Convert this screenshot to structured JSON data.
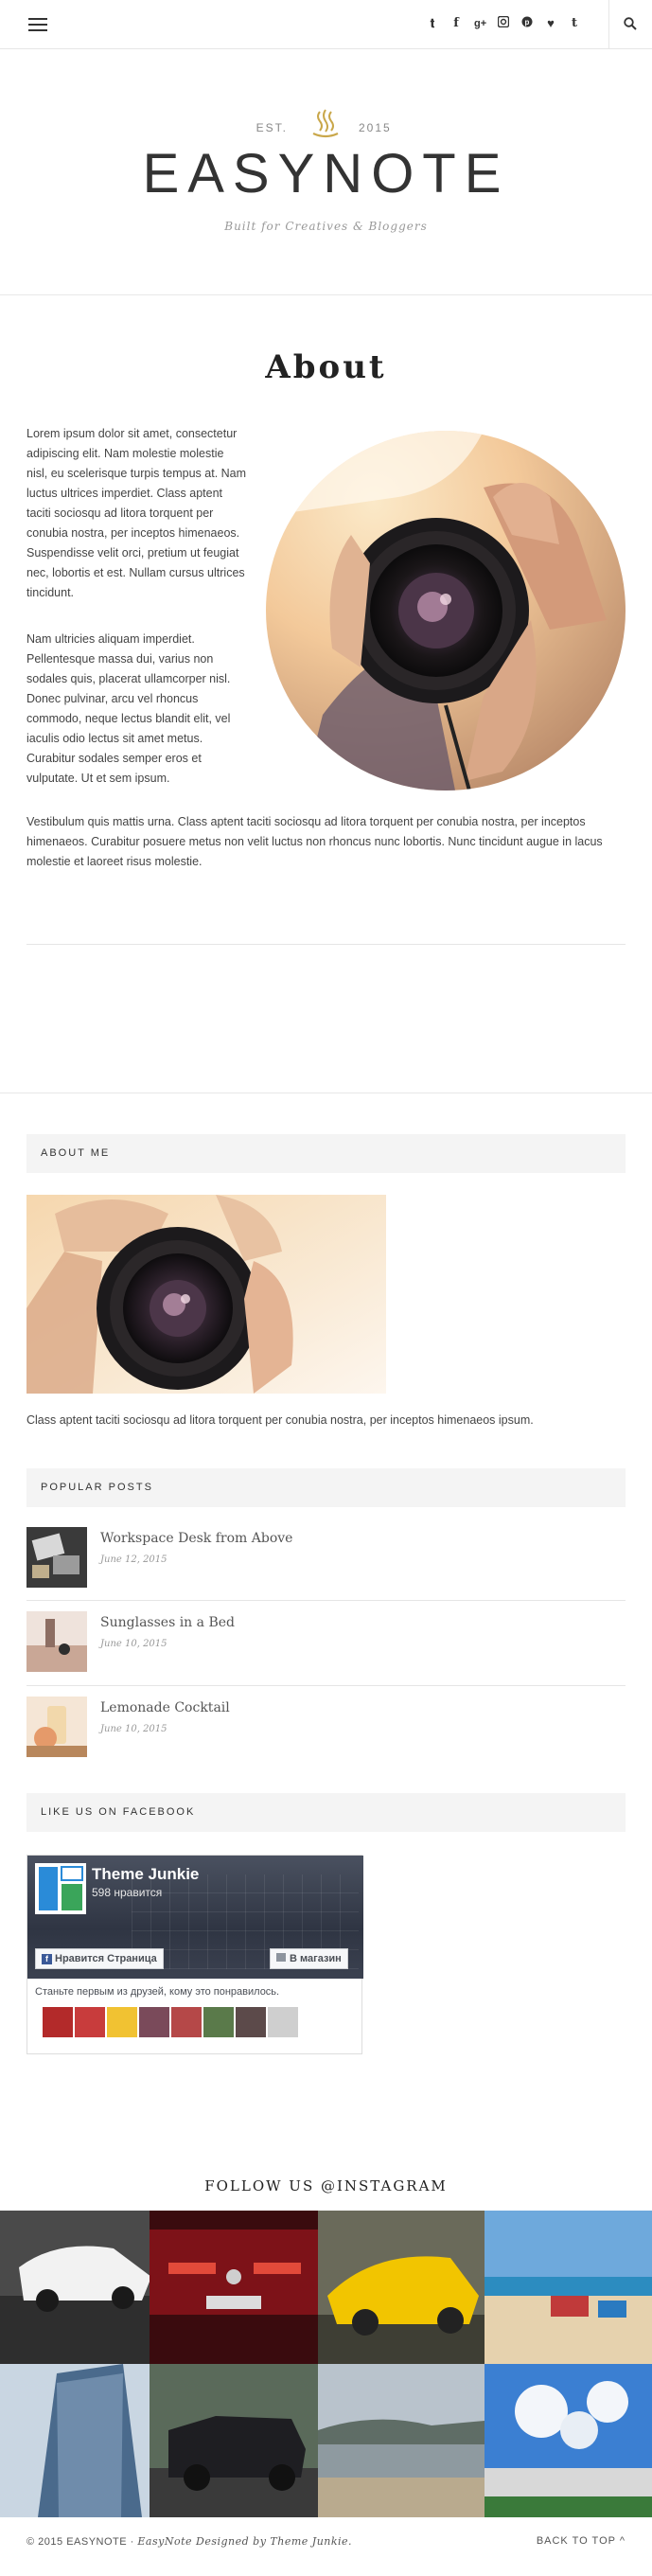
{
  "header": {
    "est": "EST.",
    "year": "2015",
    "site_title": "EASYNOTE",
    "tagline": "Built for Creatives & Bloggers",
    "social_icons": [
      "twitter-icon",
      "facebook-icon",
      "google-plus-icon",
      "instagram-icon",
      "pinterest-icon",
      "heart-icon",
      "tumblr-icon"
    ]
  },
  "page": {
    "title": "About",
    "para1": "Lorem ipsum dolor sit amet, consectetur adipiscing elit. Nam molestie molestie nisl, eu scelerisque turpis tempus at. Nam luctus ultrices imperdiet. Class aptent taciti sociosqu ad litora torquent per conubia nostra, per inceptos himenaeos. Suspendisse velit orci, pretium ut feugiat nec, lobortis et est. Nullam cursus ultrices tincidunt.",
    "para2": "Nam ultricies aliquam imperdiet. Pellentesque massa dui, varius non sodales quis, placerat ullamcorper nisl. Donec pulvinar, arcu vel rhoncus commodo, neque lectus blandit elit, vel iaculis odio lectus sit amet metus. Curabitur sodales semper eros et vulputate. Ut et sem ipsum.",
    "para3": "Vestibulum quis mattis urna. Class aptent taciti sociosqu ad litora torquent per conubia nostra, per inceptos himenaeos. Curabitur posuere metus non velit luctus non rhoncus nunc lobortis. Nunc tincidunt augue in lacus molestie et laoreet risus molestie."
  },
  "about_me": {
    "heading": "ABOUT ME",
    "text": "Class aptent taciti sociosqu ad litora torquent per conubia nostra, per inceptos himenaeos ipsum."
  },
  "popular_posts": {
    "heading": "POPULAR POSTS",
    "items": [
      {
        "title": "Workspace Desk from Above",
        "date": "June 12, 2015"
      },
      {
        "title": "Sunglasses in a Bed",
        "date": "June 10, 2015"
      },
      {
        "title": "Lemonade Cocktail",
        "date": "June 10, 2015"
      }
    ]
  },
  "facebook": {
    "heading": "LIKE US ON FACEBOOK",
    "page_name": "Theme Junkie",
    "likes": "598 нравится",
    "like_button": "Нравится Страница",
    "shop_button": "В магазин",
    "friends_text": "Станьте первым из друзей, кому это понравилось."
  },
  "instagram": {
    "heading": "FOLLOW US @INSTAGRAM"
  },
  "footer": {
    "copyright": "© 2015 EASYNOTE · ",
    "credit": "EasyNote Designed by Theme Junkie.",
    "back_to_top": "BACK TO TOP ^"
  }
}
